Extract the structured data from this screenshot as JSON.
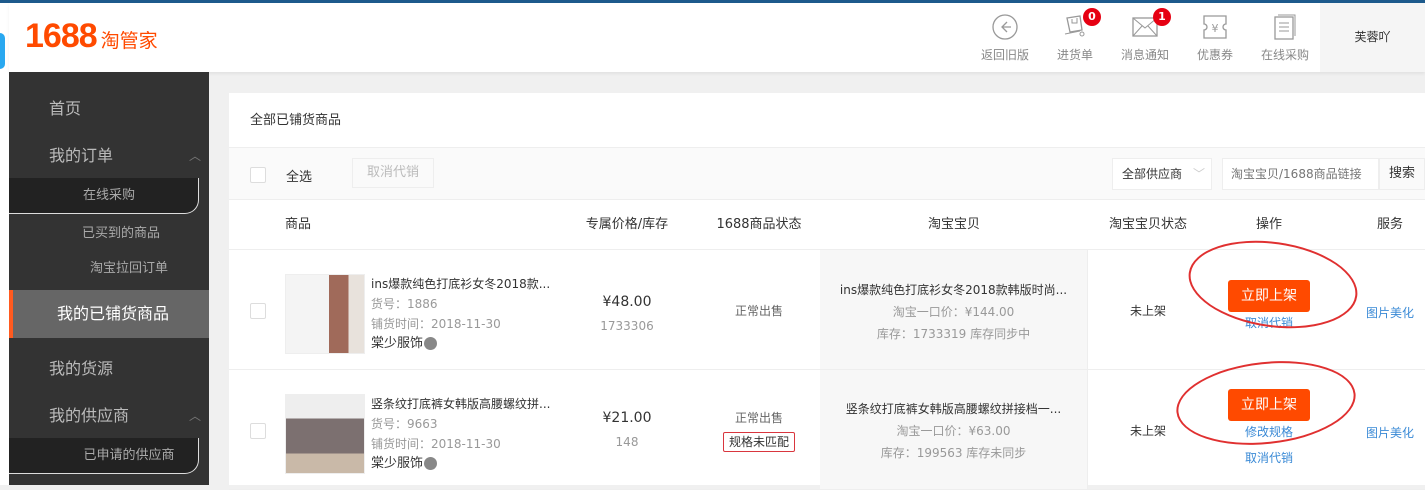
{
  "header": {
    "logo_number": "1688",
    "logo_text": "淘管家",
    "tools": [
      {
        "icon": "back-circle-icon",
        "label": "返回旧版"
      },
      {
        "icon": "cart-icon",
        "label": "进货单",
        "badge": "0"
      },
      {
        "icon": "mail-icon",
        "label": "消息通知",
        "badge": "1"
      },
      {
        "icon": "coupon-icon",
        "label": "优惠券"
      },
      {
        "icon": "document-icon",
        "label": "在线采购"
      }
    ],
    "user": "芙蓉吖"
  },
  "sidebar": {
    "items": [
      {
        "label": "首页"
      },
      {
        "label": "我的订单",
        "subs": [
          "在线采购",
          "已买到的商品",
          "淘宝拉回订单"
        ]
      },
      {
        "label": "我的已铺货商品",
        "active": true
      },
      {
        "label": "我的货源"
      },
      {
        "label": "我的供应商",
        "subs": [
          "已申请的供应商"
        ]
      }
    ]
  },
  "panel": {
    "title": "全部已铺货商品",
    "select_all": "全选",
    "cancel_button": "取消代销",
    "supplier_select": "全部供应商",
    "search_placeholder": "淘宝宝贝/1688商品链接",
    "search_button": "搜索",
    "columns": [
      "商品",
      "专属价格/库存",
      "1688商品状态",
      "淘宝宝贝",
      "淘宝宝贝状态",
      "操作",
      "服务"
    ],
    "rows": [
      {
        "title": "ins爆款纯色打底衫女冬2018款...",
        "sku": "货号：1886",
        "time": "铺货时间：2018-11-30",
        "shop": "棠少服饰",
        "price": "¥48.00",
        "stock": "1733306",
        "status": "正常出售",
        "tb_title": "ins爆款纯色打底衫女冬2018款韩版时尚...",
        "tb_price": "淘宝一口价：¥144.00",
        "tb_stock": "库存：1733319 库存同步中",
        "tb_status": "未上架",
        "action": "立即上架",
        "links": [
          "取消代销"
        ],
        "service": "图片美化"
      },
      {
        "title": "竖条纹打底裤女韩版高腰螺纹拼...",
        "sku": "货号：9663",
        "time": "铺货时间：2018-11-30",
        "shop": "棠少服饰",
        "price": "¥21.00",
        "stock": "148",
        "status": "正常出售",
        "tag": "规格未匹配",
        "tb_title": "竖条纹打底裤女韩版高腰螺纹拼接档一...",
        "tb_price": "淘宝一口价：¥63.00",
        "tb_stock": "库存：199563 库存未同步",
        "tb_status": "未上架",
        "action": "立即上架",
        "links": [
          "修改规格",
          "取消代销"
        ],
        "service": "图片美化"
      }
    ]
  },
  "colors": {
    "accent": "#ff4a00",
    "link": "#3a8ad6",
    "sidebar": "#333333",
    "annotation": "#e03030"
  }
}
